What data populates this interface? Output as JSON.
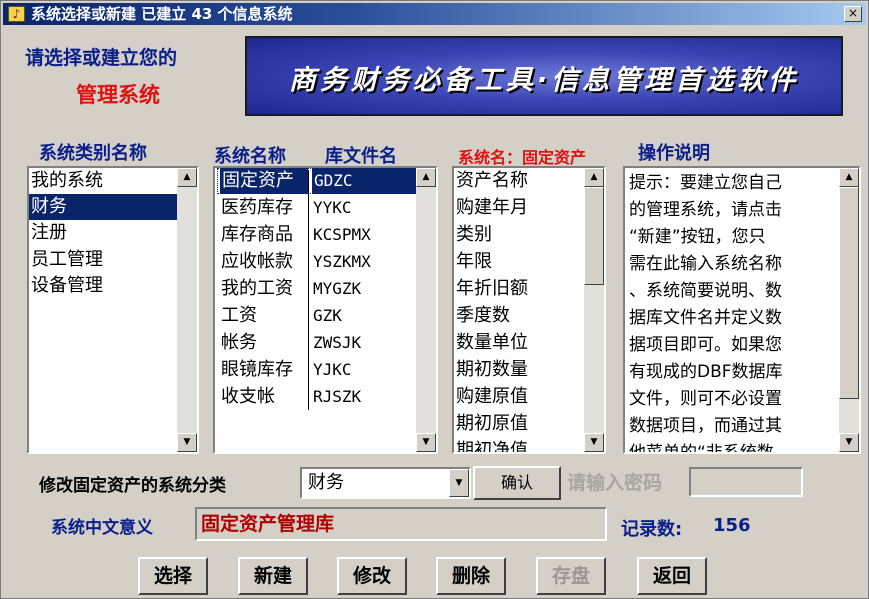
{
  "window": {
    "title": "系统选择或新建  已建立 43 个信息系统",
    "close_glyph": "×",
    "app_icon_glyph": "♪"
  },
  "prompt": {
    "line1": "请选择或建立您的",
    "line2": "管理系统"
  },
  "banner": {
    "text": "商务财务必备工具·信息管理首选软件"
  },
  "headers": {
    "category": "系统类别名称",
    "system_name": "系统名称",
    "db_file": "库文件名",
    "field_list": "系统名：固定资产",
    "help": "操作说明"
  },
  "categories": [
    {
      "label": "我的系统",
      "selected": false
    },
    {
      "label": "财务",
      "selected": true
    },
    {
      "label": "注册",
      "selected": false
    },
    {
      "label": "员工管理",
      "selected": false
    },
    {
      "label": "设备管理",
      "selected": false
    }
  ],
  "systems": [
    {
      "name": "固定资产",
      "file": "GDZC",
      "selected": true
    },
    {
      "name": "医药库存",
      "file": "YYKC",
      "selected": false
    },
    {
      "name": "库存商品",
      "file": "KCSPMX",
      "selected": false
    },
    {
      "name": "应收帐款",
      "file": "YSZKMX",
      "selected": false
    },
    {
      "name": "我的工资",
      "file": "MYGZK",
      "selected": false
    },
    {
      "name": "工资",
      "file": "GZK",
      "selected": false
    },
    {
      "name": "帐务",
      "file": "ZWSJK",
      "selected": false
    },
    {
      "name": "眼镜库存",
      "file": "YJKC",
      "selected": false
    },
    {
      "name": "收支帐",
      "file": "RJSZK",
      "selected": false
    }
  ],
  "fields": [
    "资产名称",
    "购建年月",
    "类别",
    "年限",
    "年折旧额",
    "季度数",
    "数量单位",
    "期初数量",
    "购建原值",
    "期初原值",
    "期初净值"
  ],
  "help_text": "提示：要建立您自己\n的管理系统，请点击\n“新建”按钮，您只\n需在此输入系统名称\n、系统简要说明、数\n据库文件名并定义数\n据项目即可。如果您\n有现成的DBF数据库\n文件，则可不必设置\n数据项目，而通过其\n他菜单的“非系统数\n据读入”将其读入到",
  "scroll_glyphs": {
    "up": "▲",
    "down": "▼"
  },
  "modify": {
    "label": "修改固定资产的系统分类",
    "combo_value": "财务",
    "confirm_label": "确认"
  },
  "password": {
    "label": "请输入密码",
    "value": ""
  },
  "meaning": {
    "label": "系统中文意义",
    "value": "固定资产管理库"
  },
  "record_count": {
    "label": "记录数:",
    "value": "156"
  },
  "buttons": {
    "select": "选择",
    "new": "新建",
    "modify": "修改",
    "delete": "删除",
    "save": "存盘",
    "back": "返回"
  },
  "colors": {
    "title_blue": "#0a246a",
    "label_blue": "#0b1f8a",
    "accent_red": "#e01010",
    "face": "#d4d0c8"
  }
}
